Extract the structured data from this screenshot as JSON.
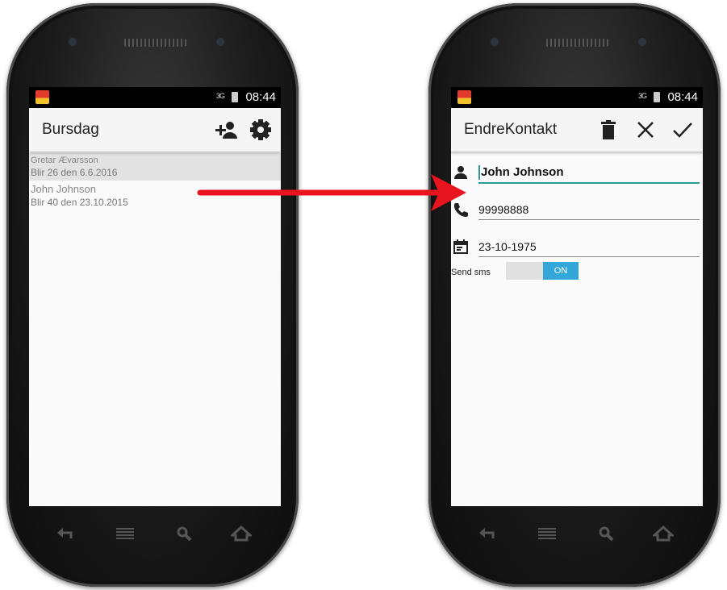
{
  "status": {
    "time": "08:44",
    "network": "3G"
  },
  "left": {
    "title": "Bursdag",
    "contacts": [
      {
        "name": "Gretar Ævarsson",
        "sub": "Blir 26 den    6.6.2016"
      },
      {
        "name": "John Johnson",
        "sub": "Blir 40 den 23.10.2015"
      }
    ]
  },
  "right": {
    "title": "EndreKontakt",
    "name_value": "John Johnson",
    "phone_value": "99998888",
    "date_value": "23-10-1975",
    "sms_label": "Send sms",
    "sms_toggle": "ON"
  },
  "colors": {
    "arrow": "#e8141e",
    "accent": "#2a9d8f",
    "toggle_on": "#33a7d9"
  },
  "icons": [
    "add-person-icon",
    "settings-icon",
    "delete-icon",
    "close-icon",
    "check-icon",
    "person-icon",
    "phone-icon",
    "calendar-icon",
    "back-icon",
    "menu-icon",
    "search-icon",
    "home-icon"
  ]
}
